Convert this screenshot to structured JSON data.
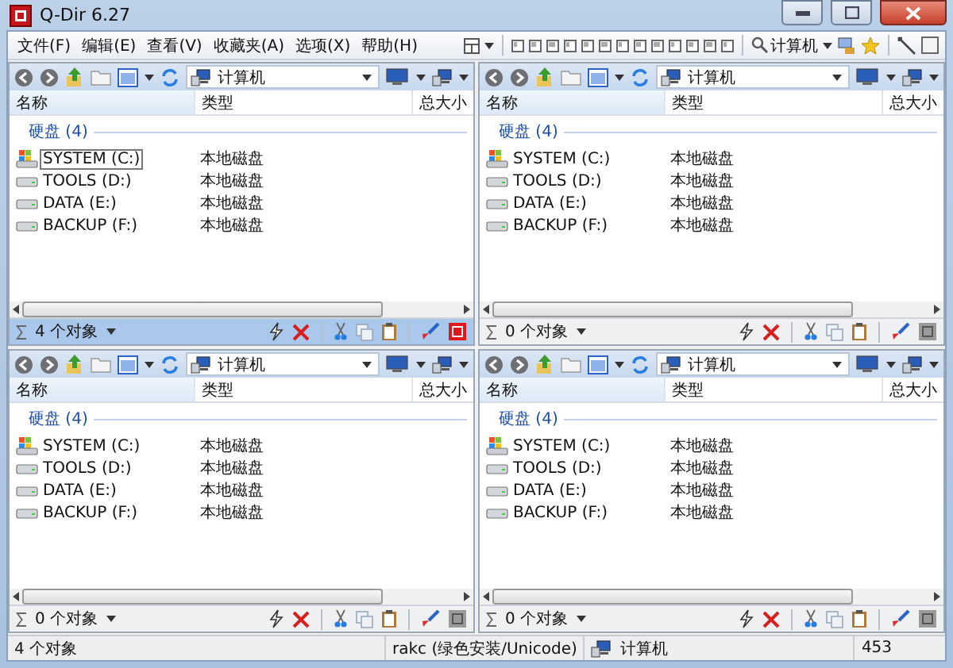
{
  "window": {
    "title": "Q-Dir 6.27"
  },
  "menu": [
    "文件(F)",
    "编辑(E)",
    "查看(V)",
    "收藏夹(A)",
    "选项(X)",
    "帮助(H)"
  ],
  "toolbar": {
    "location": "计算机"
  },
  "panes": [
    {
      "selected": true,
      "address": "计算机",
      "columns": [
        "名称",
        "类型",
        "总大小"
      ],
      "group": "硬盘 (4)",
      "count": "4 个对象",
      "rows": [
        {
          "name": "SYSTEM (C:)",
          "type": "本地磁盘",
          "kind": "system",
          "focused": true
        },
        {
          "name": "TOOLS (D:)",
          "type": "本地磁盘",
          "kind": "disk",
          "focused": false
        },
        {
          "name": "DATA (E:)",
          "type": "本地磁盘",
          "kind": "disk",
          "focused": false
        },
        {
          "name": "BACKUP (F:)",
          "type": "本地磁盘",
          "kind": "disk",
          "focused": false
        }
      ]
    },
    {
      "selected": false,
      "address": "计算机",
      "columns": [
        "名称",
        "类型",
        "总大小"
      ],
      "group": "硬盘 (4)",
      "count": "0 个对象",
      "rows": [
        {
          "name": "SYSTEM (C:)",
          "type": "本地磁盘",
          "kind": "system",
          "focused": false
        },
        {
          "name": "TOOLS (D:)",
          "type": "本地磁盘",
          "kind": "disk",
          "focused": false
        },
        {
          "name": "DATA (E:)",
          "type": "本地磁盘",
          "kind": "disk",
          "focused": false
        },
        {
          "name": "BACKUP (F:)",
          "type": "本地磁盘",
          "kind": "disk",
          "focused": false
        }
      ]
    },
    {
      "selected": false,
      "address": "计算机",
      "columns": [
        "名称",
        "类型",
        "总大小"
      ],
      "group": "硬盘 (4)",
      "count": "0 个对象",
      "rows": [
        {
          "name": "SYSTEM (C:)",
          "type": "本地磁盘",
          "kind": "system",
          "focused": false
        },
        {
          "name": "TOOLS (D:)",
          "type": "本地磁盘",
          "kind": "disk",
          "focused": false
        },
        {
          "name": "DATA (E:)",
          "type": "本地磁盘",
          "kind": "disk",
          "focused": false
        },
        {
          "name": "BACKUP (F:)",
          "type": "本地磁盘",
          "kind": "disk",
          "focused": false
        }
      ]
    },
    {
      "selected": false,
      "address": "计算机",
      "columns": [
        "名称",
        "类型",
        "总大小"
      ],
      "group": "硬盘 (4)",
      "count": "0 个对象",
      "rows": [
        {
          "name": "SYSTEM (C:)",
          "type": "本地磁盘",
          "kind": "system",
          "focused": false
        },
        {
          "name": "TOOLS (D:)",
          "type": "本地磁盘",
          "kind": "disk",
          "focused": false
        },
        {
          "name": "DATA (E:)",
          "type": "本地磁盘",
          "kind": "disk",
          "focused": false
        },
        {
          "name": "BACKUP (F:)",
          "type": "本地磁盘",
          "kind": "disk",
          "focused": false
        }
      ]
    }
  ],
  "status_bar": {
    "count": "4 个对象",
    "edition": "rakc (绿色安装/Unicode)",
    "location": "计算机",
    "value": "453"
  }
}
